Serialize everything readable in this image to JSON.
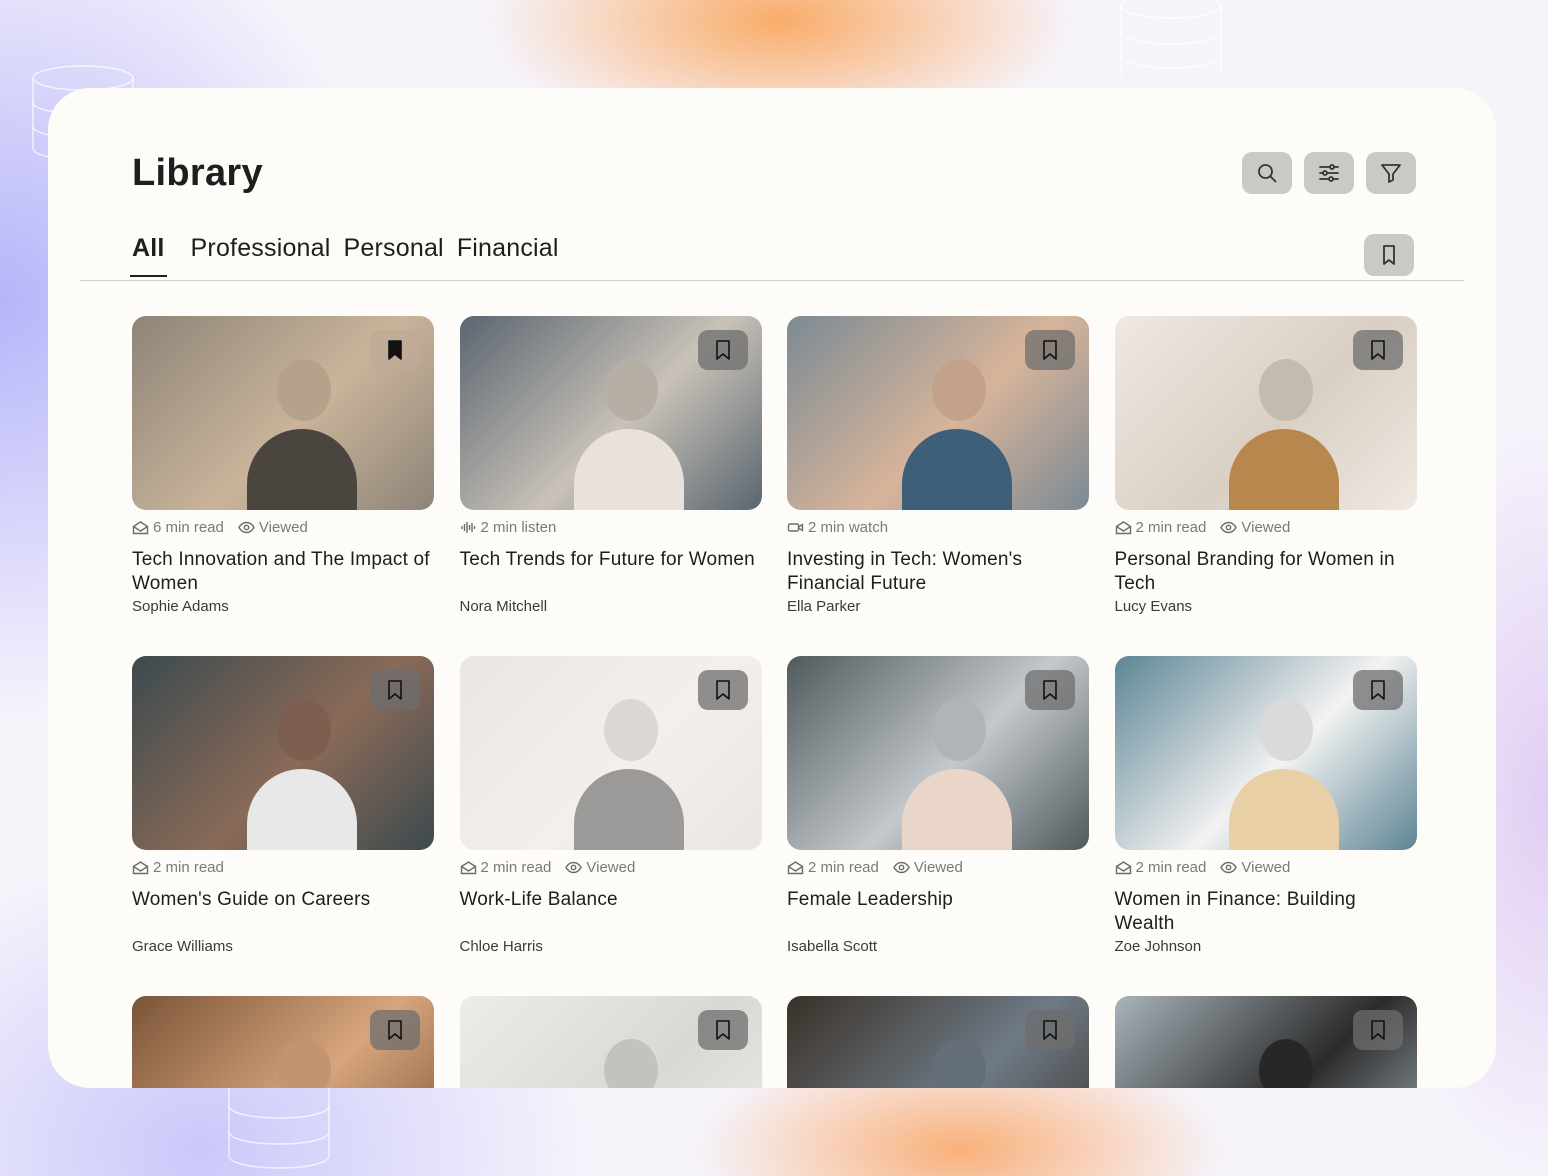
{
  "header": {
    "title": "Library",
    "actions": [
      {
        "icon": "search-icon"
      },
      {
        "icon": "sliders-icon"
      },
      {
        "icon": "filter-icon"
      }
    ]
  },
  "tabs": [
    {
      "label": "All",
      "active": true
    },
    {
      "label": "Professional",
      "active": false
    },
    {
      "label": "Personal",
      "active": false
    },
    {
      "label": "Financial",
      "active": false
    }
  ],
  "saved_button": {
    "icon": "bookmark-icon"
  },
  "cards": [
    {
      "duration": "6 min read",
      "type": "read",
      "viewed": "Viewed",
      "title": "Tech Innovation and The Impact of Women",
      "author": "Sophie Adams",
      "bookmarked": true,
      "colors": [
        "#8e8478",
        "#4b4540",
        "#c9b49a"
      ]
    },
    {
      "duration": "2 min listen",
      "type": "listen",
      "viewed": "",
      "title": "Tech Trends for Future for Women",
      "author": "Nora Mitchell",
      "bookmarked": false,
      "colors": [
        "#5a6570",
        "#e8e2da",
        "#c9c2b8"
      ]
    },
    {
      "duration": "2 min watch",
      "type": "watch",
      "viewed": "",
      "title": "Investing in Tech: Women's Financial Future",
      "author": "Ella Parker",
      "bookmarked": false,
      "colors": [
        "#7c8a94",
        "#3e5f78",
        "#d7b49a"
      ]
    },
    {
      "duration": "2 min read",
      "type": "read",
      "viewed": "Viewed",
      "title": "Personal Branding for Women in Tech",
      "author": "Lucy Evans",
      "bookmarked": false,
      "colors": [
        "#efe9e2",
        "#b8874e",
        "#d9cfc4"
      ]
    },
    {
      "duration": "2 min read",
      "type": "read",
      "viewed": "",
      "title": "Women's Guide on Careers",
      "author": "Grace Williams",
      "bookmarked": false,
      "colors": [
        "#3c4a4e",
        "#e8e8e8",
        "#8a6a58"
      ]
    },
    {
      "duration": "2 min read",
      "type": "read",
      "viewed": "Viewed",
      "title": "Work-Life Balance",
      "author": "Chloe Harris",
      "bookmarked": false,
      "colors": [
        "#e9e6e3",
        "#9c9a98",
        "#f4efea"
      ]
    },
    {
      "duration": "2 min read",
      "type": "read",
      "viewed": "Viewed",
      "title": "Female Leadership",
      "author": "Isabella Scott",
      "bookmarked": false,
      "colors": [
        "#4f5a5c",
        "#ead6c8",
        "#c4c8cc"
      ]
    },
    {
      "duration": "2 min read",
      "type": "read",
      "viewed": "Viewed",
      "title": "Women in Finance: Building Wealth",
      "author": "Zoe Johnson",
      "bookmarked": false,
      "colors": [
        "#5d8594",
        "#e9cfa5",
        "#f2f2f2"
      ]
    },
    {
      "duration": "",
      "type": "",
      "viewed": "",
      "title": "",
      "author": "",
      "bookmarked": false,
      "colors": [
        "#7a5438",
        "#2e2a28",
        "#d7a57c"
      ]
    },
    {
      "duration": "",
      "type": "",
      "viewed": "",
      "title": "",
      "author": "",
      "bookmarked": false,
      "colors": [
        "#ececea",
        "#3b2a22",
        "#d8d8d4"
      ]
    },
    {
      "duration": "",
      "type": "",
      "viewed": "",
      "title": "",
      "author": "",
      "bookmarked": false,
      "colors": [
        "#3a3128",
        "#c79a76",
        "#6e7a86"
      ]
    },
    {
      "duration": "",
      "type": "",
      "viewed": "",
      "title": "",
      "author": "",
      "bookmarked": false,
      "colors": [
        "#a9b4bc",
        "#6a4a3a",
        "#2b2b2b"
      ]
    }
  ]
}
